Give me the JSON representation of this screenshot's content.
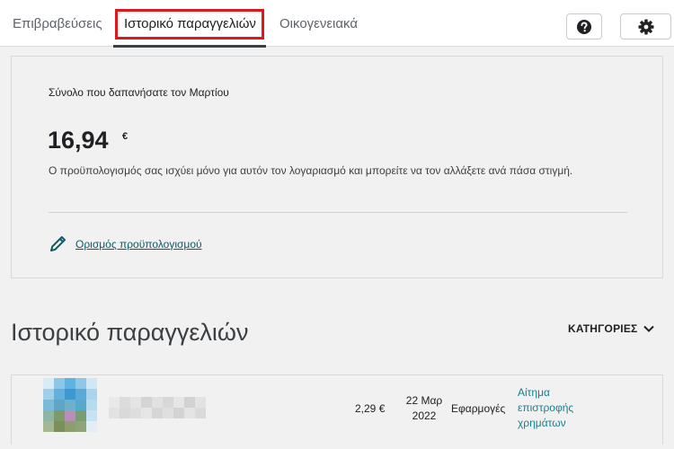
{
  "tabs": {
    "rewards": "Επιβραβεύσεις",
    "order_history": "Ιστορικό παραγγελιών",
    "family": "Οικογενειακά"
  },
  "toolbar": {
    "help_icon": "help-icon",
    "settings_icon": "gear-icon"
  },
  "budget": {
    "title": "Σύνολο που δαπανήσατε τον Μαρτίου",
    "amount": "16,94",
    "currency": "€",
    "description": "Ο προϋπολογισμός σας ισχύει μόνο για αυτόν τον λογαριασμό και μπορείτε να τον αλλάξετε ανά πάσα στιγμή.",
    "set_budget_label": "Ορισμός προϋπολογισμού",
    "set_budget_icon": "pencil-icon"
  },
  "history": {
    "title": "Ιστορικό παραγγελιών",
    "categories_label": "ΚΑΤΗΓΟΡΙΕΣ"
  },
  "orders": [
    {
      "price": "2,29 €",
      "date_line1": "22 Μαρ",
      "date_line2": "2022",
      "type": "Εφαρμογές",
      "refund_label": "Αίτημα επιστροφής χρημάτων"
    }
  ],
  "colors": {
    "active_tab_highlight": "#e0161b",
    "link": "#1a7f8e",
    "pencil": "#0b5a66"
  }
}
